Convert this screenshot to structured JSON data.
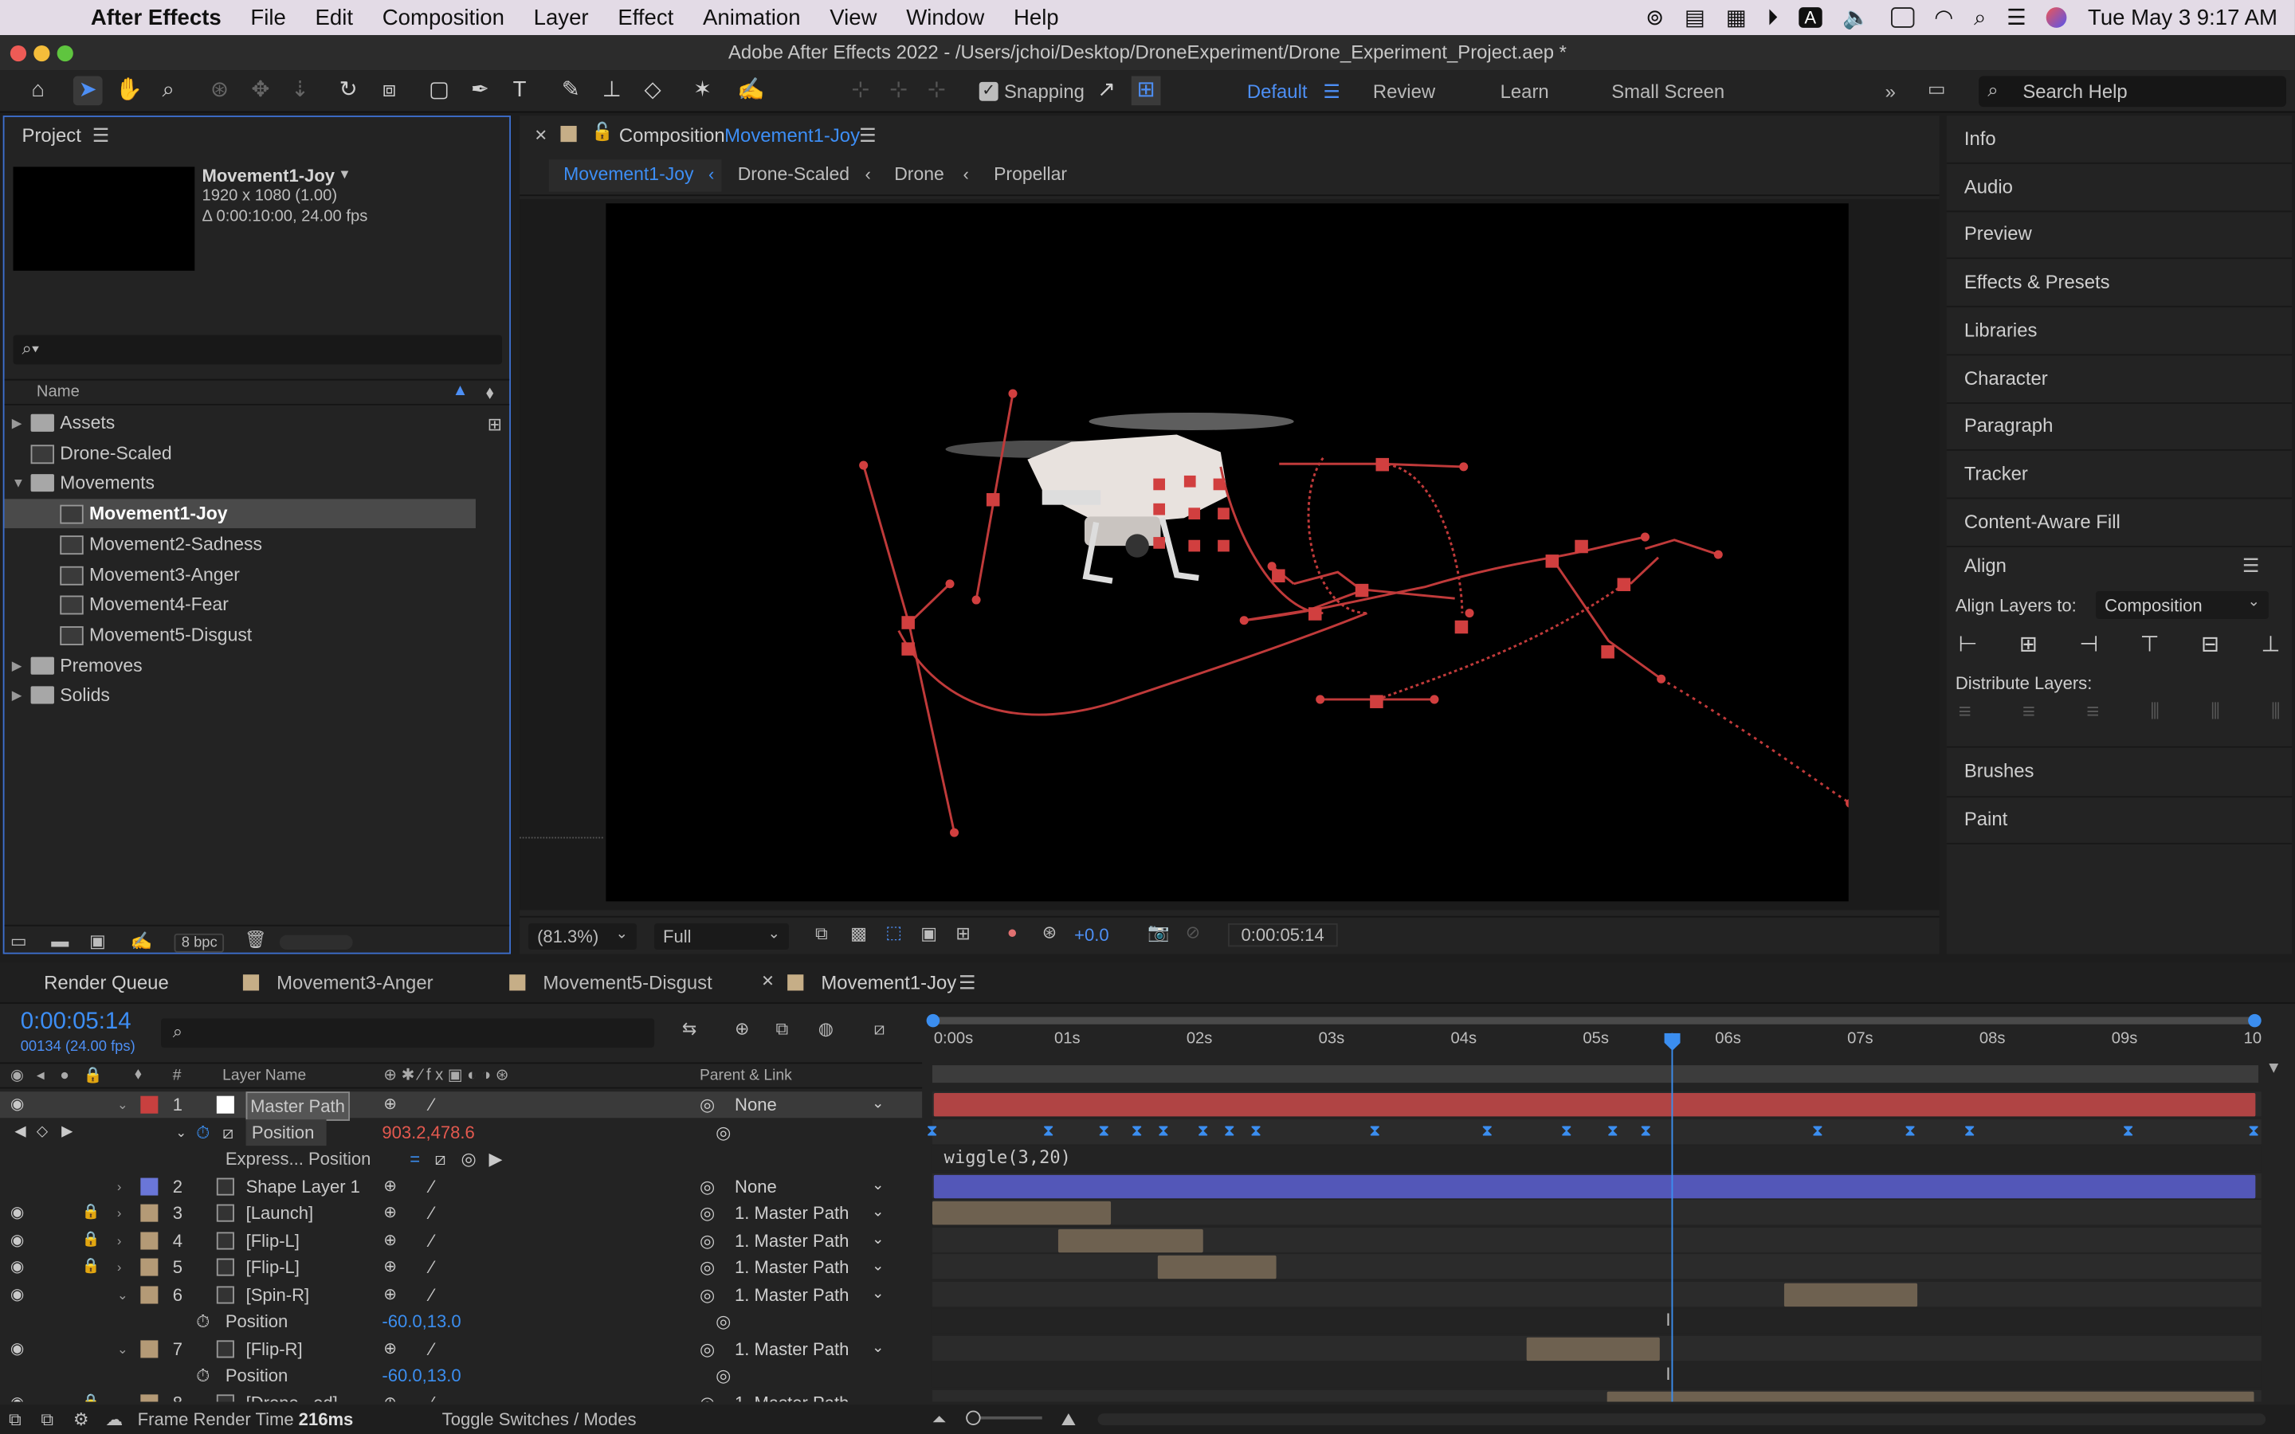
{
  "menubar": {
    "app": "After Effects",
    "items": [
      "File",
      "Edit",
      "Composition",
      "Layer",
      "Effect",
      "Animation",
      "View",
      "Window",
      "Help"
    ],
    "clock": "Tue May 3  9:17 AM",
    "input_source": "A"
  },
  "window": {
    "title": "Adobe After Effects 2022 - /Users/jchoi/Desktop/DroneExperiment/Drone_Experiment_Project.aep *"
  },
  "toolbar": {
    "snapping_label": "Snapping",
    "workspaces": [
      "Default",
      "Review",
      "Learn",
      "Small Screen"
    ],
    "search_placeholder": "Search Help"
  },
  "project": {
    "title": "Project",
    "selected_name": "Movement1-Joy",
    "selected_info1": "1920 x 1080 (1.00)",
    "selected_info2": "Δ 0:00:10:00, 24.00 fps",
    "search_icon": "⌕▾",
    "col_name": "Name",
    "items": [
      {
        "label": "Assets",
        "kind": "folder",
        "indent": 0
      },
      {
        "label": "Drone-Scaled",
        "kind": "comp",
        "indent": 0
      },
      {
        "label": "Movements",
        "kind": "folder",
        "indent": 0
      },
      {
        "label": "Movement1-Joy",
        "kind": "comp",
        "indent": 1
      },
      {
        "label": "Movement2-Sadness",
        "kind": "comp",
        "indent": 1
      },
      {
        "label": "Movement3-Anger",
        "kind": "comp",
        "indent": 1
      },
      {
        "label": "Movement4-Fear",
        "kind": "comp",
        "indent": 1
      },
      {
        "label": "Movement5-Disgust",
        "kind": "comp",
        "indent": 1
      },
      {
        "label": "Premoves",
        "kind": "folder",
        "indent": 0
      },
      {
        "label": "Solids",
        "kind": "folder",
        "indent": 0
      }
    ],
    "bpc": "8 bpc"
  },
  "composition": {
    "tab_prefix": "Composition",
    "tab_name": "Movement1-Joy",
    "breadcrumbs": [
      "Movement1-Joy",
      "Drone-Scaled",
      "Drone",
      "Propellar"
    ],
    "zoom": "(81.3%)",
    "resolution": "Full",
    "exposure": "+0.0",
    "timecode": "0:00:05:14"
  },
  "right_panels": {
    "items": [
      "Info",
      "Audio",
      "Preview",
      "Effects & Presets",
      "Libraries",
      "Character",
      "Paragraph",
      "Tracker",
      "Content-Aware Fill"
    ],
    "align_title": "Align",
    "align_to_label": "Align Layers to:",
    "align_to_value": "Composition",
    "distribute_label": "Distribute Layers:",
    "bottom_items": [
      "Brushes",
      "Paint"
    ]
  },
  "timeline": {
    "tabs": [
      "Render Queue",
      "Movement3-Anger",
      "Movement5-Disgust",
      "Movement1-Joy"
    ],
    "current_time": "0:00:05:14",
    "frame_info": "00134 (24.00 fps)",
    "col_hash": "#",
    "col_layer_name": "Layer Name",
    "col_parent": "Parent & Link",
    "ruler": [
      "0:00s",
      "01s",
      "02s",
      "03s",
      "04s",
      "05s",
      "06s",
      "07s",
      "08s",
      "09s",
      "10"
    ],
    "playhead_seconds": 5.583,
    "duration_seconds": 10,
    "layers": [
      {
        "num": "1",
        "name": "Master Path",
        "parent": "None",
        "color": "#c8403f",
        "boxed": true
      },
      {
        "num": "2",
        "name": "Shape Layer 1",
        "parent": "None",
        "color": "#6a76d8"
      },
      {
        "num": "3",
        "name": "[Launch]",
        "parent": "1. Master Path",
        "color": "#b49a76"
      },
      {
        "num": "4",
        "name": "[Flip-L]",
        "parent": "1. Master Path",
        "color": "#b49a76"
      },
      {
        "num": "5",
        "name": "[Flip-L]",
        "parent": "1. Master Path",
        "color": "#b49a76"
      },
      {
        "num": "6",
        "name": "[Spin-R]",
        "parent": "1. Master Path",
        "color": "#b49a76"
      },
      {
        "num": "7",
        "name": "[Flip-R]",
        "parent": "1. Master Path",
        "color": "#b49a76"
      },
      {
        "num": "8",
        "name": "[Drone...ed]",
        "parent": "1. Master Path",
        "color": "#b49a76"
      }
    ],
    "position_label": "Position",
    "position_value": "903.2,478.6",
    "expression_label": "Express... Position",
    "expression_text": "wiggle(3,20)",
    "sub_position_value": "-60.0,13.0",
    "position_keyframes_seconds": [
      0,
      0.88,
      1.3,
      1.55,
      1.75,
      2.05,
      2.25,
      2.45,
      3.35,
      4.2,
      4.8,
      5.15,
      5.4,
      6.7,
      7.4,
      7.85,
      9.05,
      10
    ]
  },
  "statusbar": {
    "frame_render_label": "Frame Render Time",
    "frame_render_value": "216ms",
    "toggle_label": "Toggle Switches / Modes"
  }
}
